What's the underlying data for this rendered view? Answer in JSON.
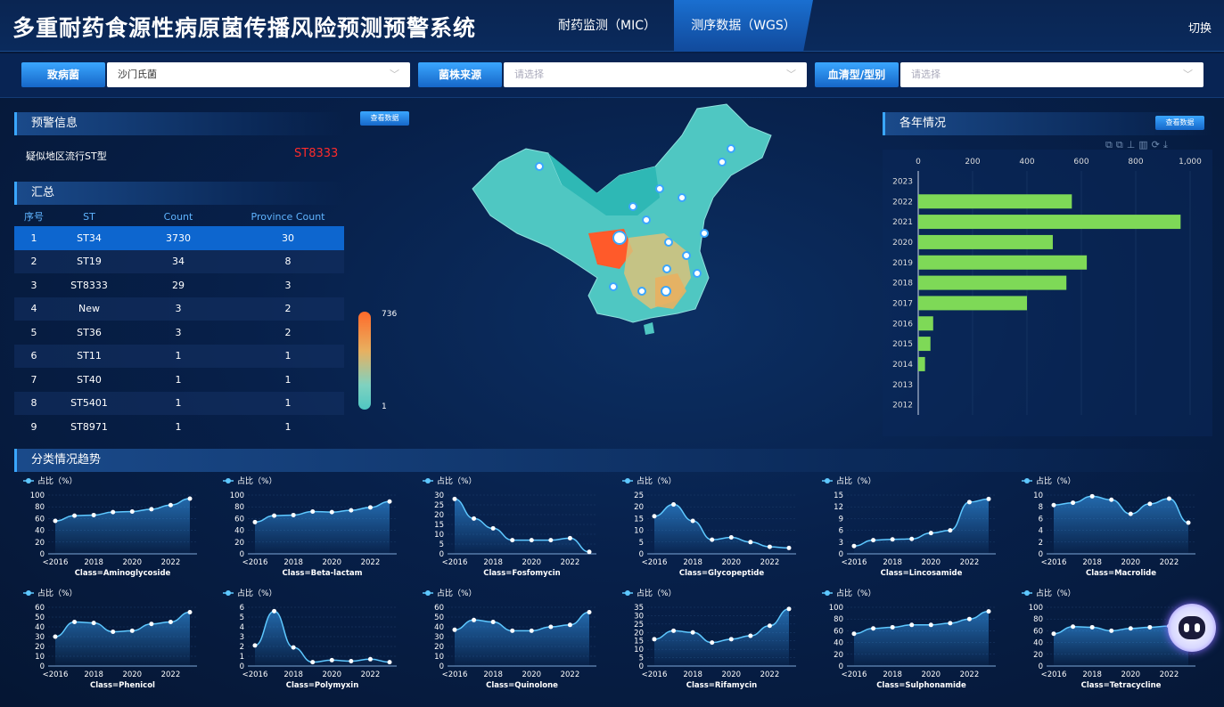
{
  "header": {
    "title": "多重耐药食源性病原菌传播风险预测预警系统",
    "nav": [
      "耐药监测（MIC）",
      "测序数据（WGS）"
    ],
    "switch": "切换"
  },
  "filters": [
    {
      "label": "致病菌",
      "value": "沙门氏菌",
      "placeholder": ""
    },
    {
      "label": "菌株来源",
      "value": "",
      "placeholder": "请选择"
    },
    {
      "label": "血清型/型别",
      "value": "",
      "placeholder": "请选择"
    }
  ],
  "warning": {
    "title": "预警信息",
    "button": "查看数据",
    "text": "疑似地区流行ST型",
    "st": "ST8333"
  },
  "summary": {
    "title": "汇总",
    "headers": [
      "序号",
      "ST",
      "Count",
      "Province Count"
    ],
    "rows": [
      [
        "1",
        "ST34",
        "3730",
        "30"
      ],
      [
        "2",
        "ST19",
        "34",
        "8"
      ],
      [
        "3",
        "ST8333",
        "29",
        "3"
      ],
      [
        "4",
        "New",
        "3",
        "2"
      ],
      [
        "5",
        "ST36",
        "3",
        "2"
      ],
      [
        "6",
        "ST11",
        "1",
        "1"
      ],
      [
        "7",
        "ST40",
        "1",
        "1"
      ],
      [
        "8",
        "ST5401",
        "1",
        "1"
      ],
      [
        "9",
        "ST8971",
        "1",
        "1"
      ]
    ]
  },
  "map": {
    "legend_max": "736",
    "legend_min": "1"
  },
  "year_panel": {
    "title": "各年情况",
    "button": "查看数据"
  },
  "trend_title": "分类情况趋势",
  "colors": {
    "accent": "#1667c8",
    "bar": "#7ed957",
    "line": "#5ec8ff",
    "alert": "#ff2b2b"
  },
  "chart_data": [
    {
      "type": "bar",
      "orientation": "horizontal",
      "categories": [
        "2012",
        "2013",
        "2014",
        "2015",
        "2016",
        "2017",
        "2018",
        "2019",
        "2020",
        "2021",
        "2022",
        "2023"
      ],
      "values": [
        0,
        0,
        25,
        45,
        55,
        400,
        545,
        620,
        495,
        965,
        565,
        0
      ],
      "xticks": [
        "0",
        "200",
        "400",
        "600",
        "800",
        "1,000"
      ],
      "xlim": [
        0,
        1000
      ]
    },
    {
      "type": "area",
      "legend": "占比（%）",
      "xlabel": "Class=Aminoglycoside",
      "x": [
        "<2016",
        "2017",
        "2018",
        "2019",
        "2020",
        "2021",
        "2022",
        "2023"
      ],
      "xticks": [
        "<2016",
        "2018",
        "2020",
        "2022"
      ],
      "yticks": [
        "0",
        "20",
        "40",
        "60",
        "80",
        "100"
      ],
      "ylim": [
        0,
        100
      ],
      "values": [
        56,
        65,
        66,
        71,
        72,
        76,
        83,
        94
      ]
    },
    {
      "type": "area",
      "legend": "占比（%）",
      "xlabel": "Class=Beta-lactam",
      "x": [
        "<2016",
        "2017",
        "2018",
        "2019",
        "2020",
        "2021",
        "2022",
        "2023"
      ],
      "xticks": [
        "<2016",
        "2018",
        "2020",
        "2022"
      ],
      "yticks": [
        "0",
        "20",
        "40",
        "60",
        "80",
        "100"
      ],
      "ylim": [
        0,
        100
      ],
      "values": [
        54,
        65,
        66,
        72,
        71,
        74,
        79,
        89
      ]
    },
    {
      "type": "area",
      "legend": "占比（%）",
      "xlabel": "Class=Fosfomycin",
      "x": [
        "<2016",
        "2017",
        "2018",
        "2019",
        "2020",
        "2021",
        "2022",
        "2023"
      ],
      "xticks": [
        "<2016",
        "2018",
        "2020",
        "2022"
      ],
      "yticks": [
        "0",
        "5",
        "10",
        "15",
        "20",
        "25",
        "30"
      ],
      "ylim": [
        0,
        30
      ],
      "values": [
        28,
        18,
        13,
        7,
        7,
        7,
        8,
        1
      ]
    },
    {
      "type": "area",
      "legend": "占比（%）",
      "xlabel": "Class=Glycopeptide",
      "x": [
        "<2016",
        "2017",
        "2018",
        "2019",
        "2020",
        "2021",
        "2022",
        "2023"
      ],
      "xticks": [
        "<2016",
        "2018",
        "2020",
        "2022"
      ],
      "yticks": [
        "0",
        "5",
        "10",
        "15",
        "20",
        "25"
      ],
      "ylim": [
        0,
        25
      ],
      "values": [
        16,
        21,
        14,
        6,
        7,
        5,
        3,
        2.5
      ]
    },
    {
      "type": "area",
      "legend": "占比（%）",
      "xlabel": "Class=Lincosamide",
      "x": [
        "<2016",
        "2017",
        "2018",
        "2019",
        "2020",
        "2021",
        "2022",
        "2023"
      ],
      "xticks": [
        "<2016",
        "2018",
        "2020",
        "2022"
      ],
      "yticks": [
        "0",
        "3",
        "6",
        "9",
        "12",
        "15"
      ],
      "ylim": [
        0,
        15
      ],
      "values": [
        2,
        3.5,
        3.7,
        3.8,
        5.3,
        6,
        13.2,
        14
      ]
    },
    {
      "type": "area",
      "legend": "占比（%）",
      "xlabel": "Class=Macrolide",
      "x": [
        "<2016",
        "2017",
        "2018",
        "2019",
        "2020",
        "2021",
        "2022",
        "2023"
      ],
      "xticks": [
        "<2016",
        "2018",
        "2020",
        "2022"
      ],
      "yticks": [
        "0",
        "2",
        "4",
        "6",
        "8",
        "10"
      ],
      "ylim": [
        0,
        10
      ],
      "values": [
        8.3,
        8.7,
        9.8,
        9.2,
        6.8,
        8.5,
        9.4,
        5.3
      ]
    },
    {
      "type": "area",
      "legend": "占比（%）",
      "xlabel": "Class=Phenicol",
      "x": [
        "<2016",
        "2017",
        "2018",
        "2019",
        "2020",
        "2021",
        "2022",
        "2023"
      ],
      "xticks": [
        "<2016",
        "2018",
        "2020",
        "2022"
      ],
      "yticks": [
        "0",
        "10",
        "20",
        "30",
        "40",
        "50",
        "60"
      ],
      "ylim": [
        0,
        60
      ],
      "values": [
        30,
        45,
        44,
        35,
        36,
        43,
        45,
        55
      ]
    },
    {
      "type": "area",
      "legend": "占比（%）",
      "xlabel": "Class=Polymyxin",
      "x": [
        "<2016",
        "2017",
        "2018",
        "2019",
        "2020",
        "2021",
        "2022",
        "2023"
      ],
      "xticks": [
        "<2016",
        "2018",
        "2020",
        "2022"
      ],
      "yticks": [
        "0",
        "1",
        "2",
        "3",
        "4",
        "5",
        "6"
      ],
      "ylim": [
        0,
        6
      ],
      "values": [
        2.1,
        5.6,
        1.9,
        0.4,
        0.6,
        0.5,
        0.7,
        0.4
      ]
    },
    {
      "type": "area",
      "legend": "占比（%）",
      "xlabel": "Class=Quinolone",
      "x": [
        "<2016",
        "2017",
        "2018",
        "2019",
        "2020",
        "2021",
        "2022",
        "2023"
      ],
      "xticks": [
        "<2016",
        "2018",
        "2020",
        "2022"
      ],
      "yticks": [
        "0",
        "10",
        "20",
        "30",
        "40",
        "50",
        "60"
      ],
      "ylim": [
        0,
        60
      ],
      "values": [
        37,
        47,
        45,
        36,
        36,
        40,
        42,
        55
      ]
    },
    {
      "type": "area",
      "legend": "占比（%）",
      "xlabel": "Class=Rifamycin",
      "x": [
        "<2016",
        "2017",
        "2018",
        "2019",
        "2020",
        "2021",
        "2022",
        "2023"
      ],
      "xticks": [
        "<2016",
        "2018",
        "2020",
        "2022"
      ],
      "yticks": [
        "0",
        "5",
        "10",
        "15",
        "20",
        "25",
        "30",
        "35"
      ],
      "ylim": [
        0,
        35
      ],
      "values": [
        16,
        21,
        20,
        14,
        16,
        18,
        24,
        34
      ]
    },
    {
      "type": "area",
      "legend": "占比（%）",
      "xlabel": "Class=Sulphonamide",
      "x": [
        "<2016",
        "2017",
        "2018",
        "2019",
        "2020",
        "2021",
        "2022",
        "2023"
      ],
      "xticks": [
        "<2016",
        "2018",
        "2020",
        "2022"
      ],
      "yticks": [
        "0",
        "20",
        "40",
        "60",
        "80",
        "100"
      ],
      "ylim": [
        0,
        100
      ],
      "values": [
        55,
        64,
        66,
        70,
        70,
        73,
        80,
        93
      ]
    },
    {
      "type": "area",
      "legend": "占比（%）",
      "xlabel": "Class=Tetracycline",
      "x": [
        "<2016",
        "2017",
        "2018",
        "2019",
        "2020",
        "2021",
        "2022",
        "2023"
      ],
      "xticks": [
        "<2016",
        "2018",
        "2020",
        "2022"
      ],
      "yticks": [
        "0",
        "20",
        "40",
        "60",
        "80",
        "100"
      ],
      "ylim": [
        0,
        100
      ],
      "values": [
        55,
        67,
        66,
        60,
        64,
        66,
        68,
        70
      ]
    }
  ]
}
